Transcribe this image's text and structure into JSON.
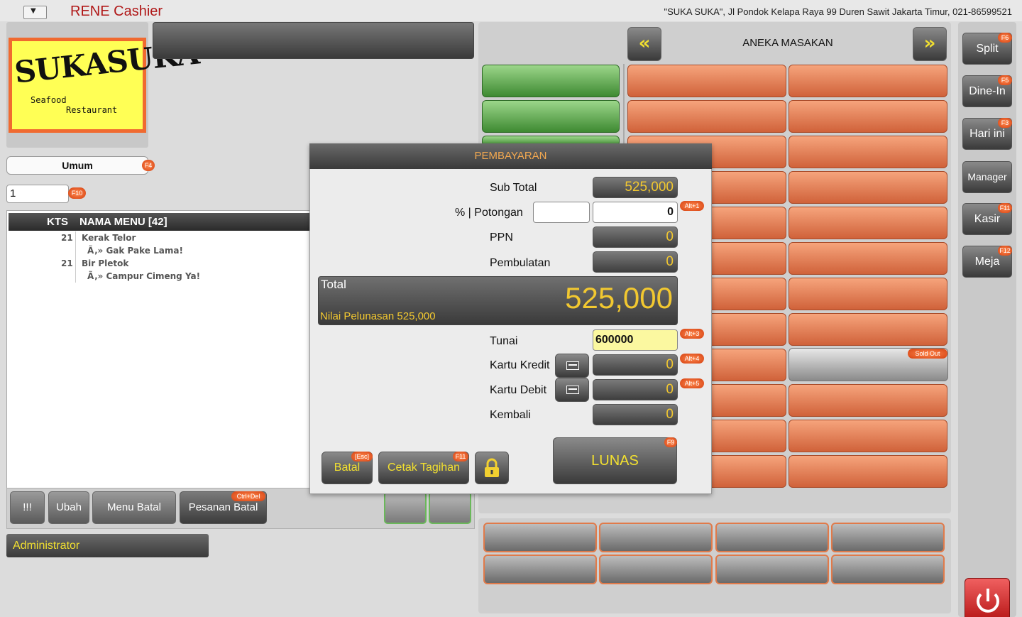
{
  "app": {
    "title": "RENE Cashier",
    "address": "\"SUKA SUKA\", Jl Pondok Kelapa Raya 99 Duren Sawit Jakarta Timur, 021-86599521"
  },
  "logo": {
    "name": "SUKASUKA",
    "line1": "Seafood",
    "line2": "Restaurant"
  },
  "customer": {
    "value": "Umum",
    "shortcut": "F4"
  },
  "table": {
    "value": "1",
    "shortcut": "F10"
  },
  "order": {
    "col_qty": "KTS",
    "col_menu": "NAMA MENU  [42]",
    "rows": [
      {
        "qty": "21",
        "name": "Kerak Telor",
        "note": "Ã‚» Gak Pake Lama!"
      },
      {
        "qty": "21",
        "name": "Bir Pletok",
        "note": "Ã‚» Campur Cimeng Ya!"
      }
    ]
  },
  "actions": {
    "alert": "!!!",
    "edit": "Ubah",
    "cancel_menu": "Menu Batal",
    "cancel_order": "Pesanan Batal",
    "cancel_order_shortcut": "Ctrl+Del"
  },
  "user": "Administrator",
  "menu": {
    "category": "ANEKA MASAKAN",
    "prev": "«",
    "next": "»",
    "sold_out": "Sold Out"
  },
  "sidebar": [
    {
      "label": "Split",
      "shortcut": "F6"
    },
    {
      "label": "Dine-In",
      "shortcut": "F5"
    },
    {
      "label": "Hari ini",
      "shortcut": "F3"
    },
    {
      "label": "Manager",
      "shortcut": ""
    },
    {
      "label": "Kasir",
      "shortcut": "F11"
    },
    {
      "label": "Meja",
      "shortcut": "F12"
    }
  ],
  "payment": {
    "title": "PEMBAYARAN",
    "subtotal_label": "Sub Total",
    "subtotal": "525,000",
    "discount_label": "% | Potongan",
    "discount_pct": "",
    "discount_amount": "0",
    "discount_shortcut": "Alt+1",
    "tax_label": "PPN",
    "tax": "0",
    "rounding_label": "Pembulatan",
    "rounding": "0",
    "total_label": "Total",
    "total": "525,000",
    "settlement_text": "Nilai Pelunasan 525,000",
    "cash_label": "Tunai",
    "cash": "600000",
    "cash_shortcut": "Alt+3",
    "credit_label": "Kartu Kredit",
    "credit": "0",
    "credit_shortcut": "Alt+4",
    "debit_label": "Kartu Debit",
    "debit": "0",
    "debit_shortcut": "Alt+5",
    "change_label": "Kembali",
    "change": "0",
    "cancel_btn": "Batal",
    "cancel_shortcut": "[Esc]",
    "print_btn": "Cetak Tagihan",
    "print_shortcut": "F11",
    "paid_btn": "LUNAS",
    "paid_shortcut": "F9"
  }
}
